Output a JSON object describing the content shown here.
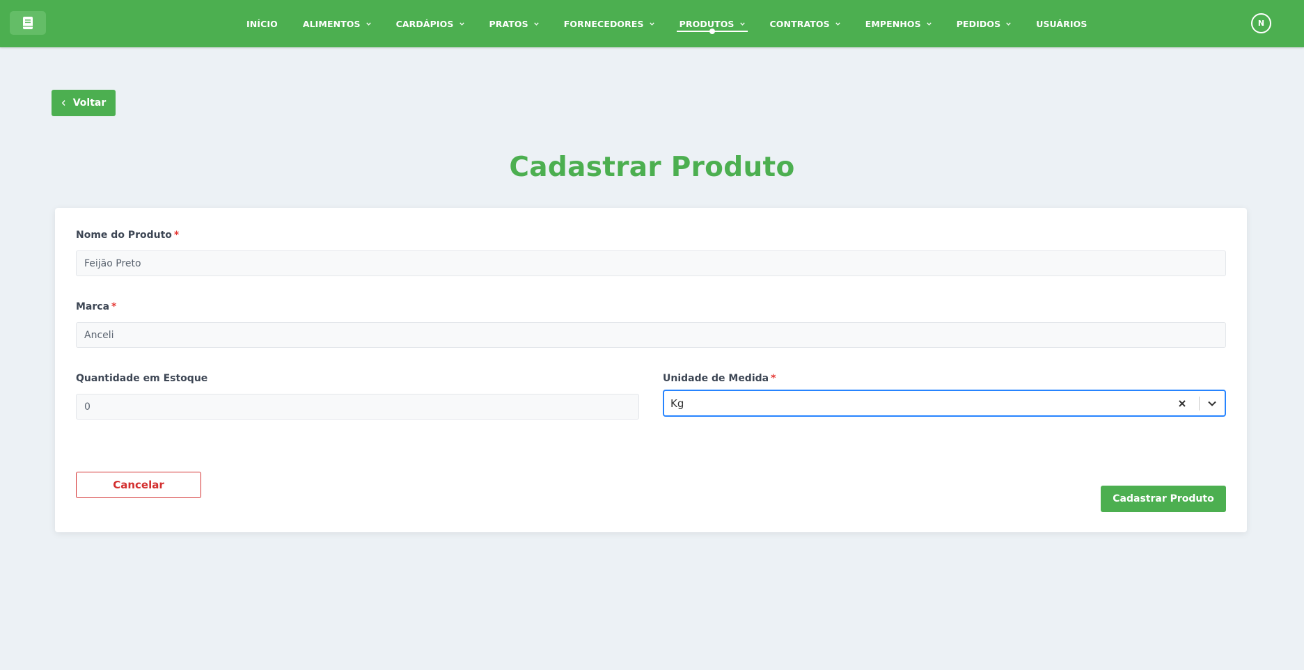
{
  "colors": {
    "primary": "#4caf50",
    "danger": "#d32f2f",
    "required": "#e53935",
    "focus": "#2684ff"
  },
  "navbar": {
    "logo_icon": "book-icon",
    "items": [
      {
        "label": "INÍCIO",
        "has_dropdown": false,
        "active": false
      },
      {
        "label": "ALIMENTOS",
        "has_dropdown": true,
        "active": false
      },
      {
        "label": "CARDÁPIOS",
        "has_dropdown": true,
        "active": false
      },
      {
        "label": "PRATOS",
        "has_dropdown": true,
        "active": false
      },
      {
        "label": "FORNECEDORES",
        "has_dropdown": true,
        "active": false
      },
      {
        "label": "PRODUTOS",
        "has_dropdown": true,
        "active": true
      },
      {
        "label": "CONTRATOS",
        "has_dropdown": true,
        "active": false
      },
      {
        "label": "EMPENHOS",
        "has_dropdown": true,
        "active": false
      },
      {
        "label": "PEDIDOS",
        "has_dropdown": true,
        "active": false
      },
      {
        "label": "USUÁRIOS",
        "has_dropdown": false,
        "active": false
      }
    ],
    "avatar_initial": "N"
  },
  "back_button": {
    "label": "Voltar",
    "icon": "chevron-left-icon"
  },
  "page_title": "Cadastrar Produto",
  "form": {
    "product_name": {
      "label": "Nome do Produto",
      "required_mark": "*",
      "value": "Feijão Preto"
    },
    "brand": {
      "label": "Marca",
      "required_mark": "*",
      "value": "Anceli"
    },
    "stock_quantity": {
      "label": "Quantidade em Estoque",
      "value": "0"
    },
    "unit": {
      "label": "Unidade de Medida",
      "required_mark": "*",
      "value": "Kg",
      "clear_icon": "close-icon",
      "dropdown_icon": "chevron-down-icon"
    },
    "cancel_label": "Cancelar",
    "submit_label": "Cadastrar Produto"
  }
}
